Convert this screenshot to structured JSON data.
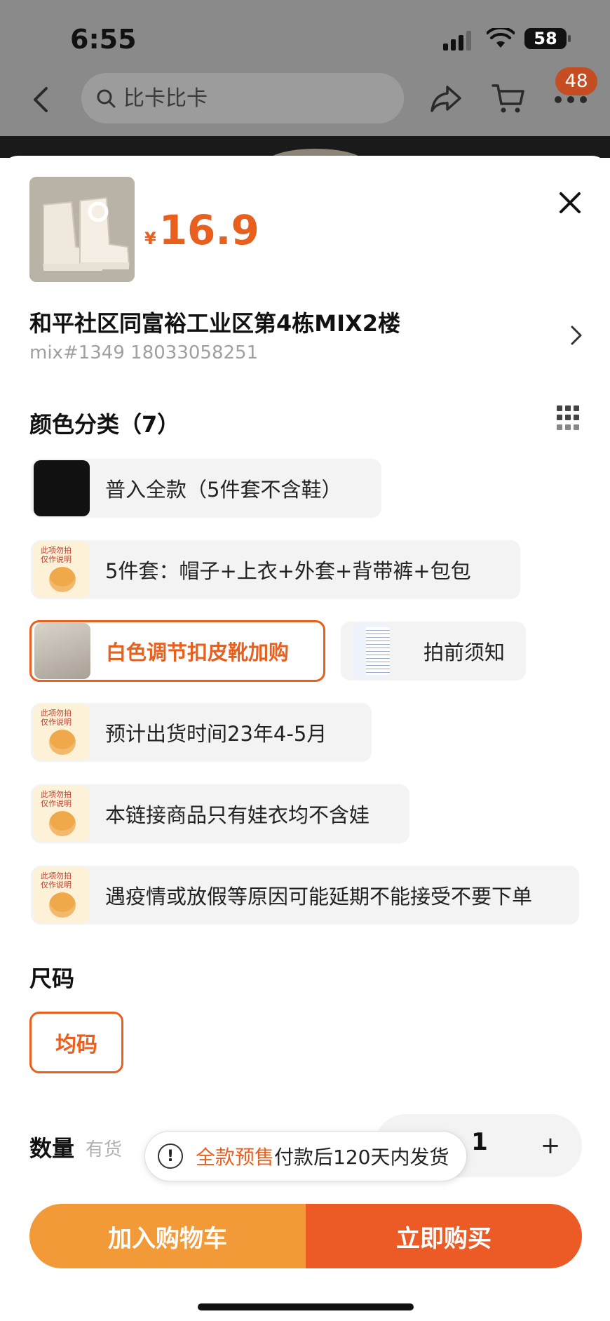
{
  "status": {
    "time": "6:55",
    "battery": "58"
  },
  "nav": {
    "search_placeholder": "比卡比卡",
    "cart_badge": "48"
  },
  "product": {
    "currency": "¥",
    "price": "16.9"
  },
  "address": {
    "title": "和平社区同富裕工业区第4栋MIX2楼",
    "subtitle": "mix#1349 18033058251"
  },
  "color_section": {
    "title": "颜色分类（7）",
    "options": [
      {
        "label": "普入全款（5件套不含鞋）",
        "selected": false
      },
      {
        "label": "5件套：帽子+上衣+外套+背带裤+包包",
        "selected": false
      },
      {
        "label": "白色调节扣皮靴加购",
        "selected": true
      },
      {
        "label": "拍前须知",
        "selected": false
      },
      {
        "label": "预计出货时间23年4-5月",
        "selected": false
      },
      {
        "label": "本链接商品只有娃衣均不含娃",
        "selected": false
      },
      {
        "label": "遇疫情或放假等原因可能延期不能接受不要下单",
        "selected": false
      }
    ]
  },
  "size_section": {
    "title": "尺码",
    "option": "均码"
  },
  "quantity": {
    "label": "数量",
    "stock": "有货",
    "value": "1",
    "plus": "+"
  },
  "toast": {
    "highlight": "全款预售",
    "text": "付款后120天内发货",
    "icon": "!"
  },
  "actions": {
    "add_to_cart": "加入购物车",
    "buy_now": "立即购买"
  },
  "colors": {
    "accent": "#e85f1e",
    "cart_button": "#f29a38",
    "buy_button": "#ec5b26"
  }
}
